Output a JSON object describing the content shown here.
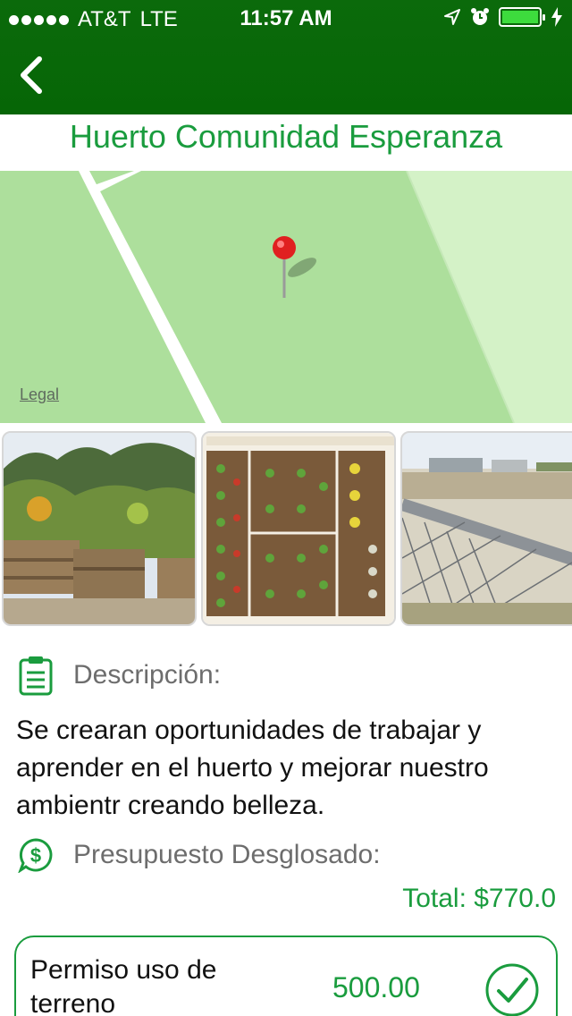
{
  "status_bar": {
    "carrier": "AT&T",
    "network": "LTE",
    "time": "11:57 AM"
  },
  "nav": {
    "back_icon": "chevron-left-icon"
  },
  "page": {
    "title": "Huerto Comunidad Esperanza"
  },
  "map": {
    "legal_label": "Legal",
    "pin_color": "#e02020"
  },
  "photos": [
    {
      "name": "garden-beds-photo"
    },
    {
      "name": "vegetable-plan-photo"
    },
    {
      "name": "empty-lot-photo"
    }
  ],
  "description": {
    "label": "Descripción:",
    "text": "Se crearan oportunidades de trabajar y aprender en el huerto y mejorar nuestro ambientr creando belleza."
  },
  "budget": {
    "label": "Presupuesto Desglosado:",
    "total": "Total: $770.0",
    "items": [
      {
        "name": "Permiso uso de terreno",
        "amount": "500.00"
      }
    ]
  },
  "colors": {
    "accent": "#1a9c3e",
    "nav_bg": "#0b6a0b"
  }
}
